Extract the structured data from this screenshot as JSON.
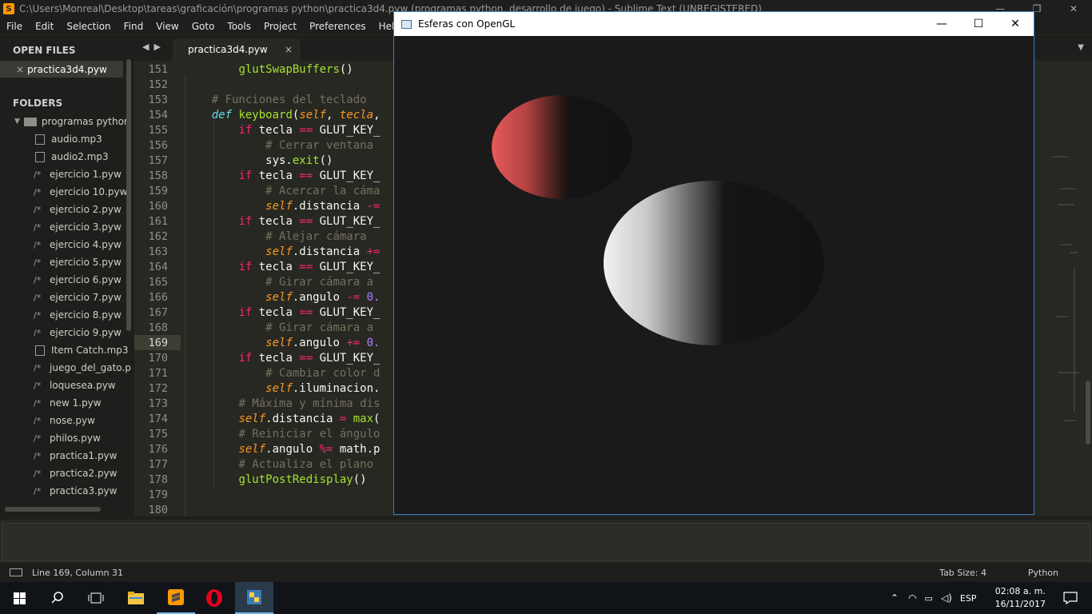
{
  "sublime": {
    "title": "C:\\Users\\Monreal\\Desktop\\tareas\\graficación\\programas python\\practica3d4.pyw (programas python, desarrollo de juego) - Sublime Text (UNREGISTERED)",
    "menu": [
      "File",
      "Edit",
      "Selection",
      "Find",
      "View",
      "Goto",
      "Tools",
      "Project",
      "Preferences",
      "Help"
    ],
    "sidebar": {
      "open_files_header": "OPEN FILES",
      "open_file": "practica3d4.pyw",
      "folders_header": "FOLDERS",
      "folder": "programas python",
      "files": [
        "audio.mp3",
        "audio2.mp3",
        "ejercicio 1.pyw",
        "ejercicio 10.pyw",
        "ejercicio 2.pyw",
        "ejercicio 3.pyw",
        "ejercicio 4.pyw",
        "ejercicio 5.pyw",
        "ejercicio 6.pyw",
        "ejercicio 7.pyw",
        "ejercicio 8.pyw",
        "ejercicio 9.pyw",
        "Item Catch.mp3",
        "juego_del_gato.p",
        "loquesea.pyw",
        "new 1.pyw",
        "nose.pyw",
        "philos.pyw",
        "practica1.pyw",
        "practica2.pyw",
        "practica3.pyw"
      ]
    },
    "tab": {
      "label": "practica3d4.pyw",
      "close": "×"
    },
    "line_numbers": [
      "151",
      "152",
      "153",
      "154",
      "155",
      "156",
      "157",
      "158",
      "159",
      "160",
      "161",
      "162",
      "163",
      "164",
      "165",
      "166",
      "167",
      "168",
      "169",
      "170",
      "171",
      "172",
      "173",
      "174",
      "175",
      "176",
      "177",
      "178",
      "179",
      "180"
    ],
    "current_line": "169",
    "status": {
      "position": "Line 169, Column 31",
      "tab_size": "Tab Size: 4",
      "syntax": "Python"
    }
  },
  "opengl_window": {
    "title": "Esferas con OpenGL",
    "background": "#1a1a1a",
    "spheres": [
      {
        "name": "red-sphere",
        "color": "#e05555"
      },
      {
        "name": "white-sphere",
        "color": "#f0f0f0"
      }
    ]
  },
  "taskbar": {
    "language": "ESP",
    "time": "02:08 a. m.",
    "date": "16/11/2017",
    "apps": [
      "file-explorer",
      "sublime-text",
      "opera",
      "python"
    ]
  },
  "colors": {
    "editor_bg": "#272822",
    "sidebar_bg": "#1e1f1c",
    "keyword": "#f92672",
    "function": "#a6e22e",
    "comment": "#75715e",
    "self": "#fd971f",
    "number": "#ae81ff",
    "accent": "#3b7fc4"
  }
}
